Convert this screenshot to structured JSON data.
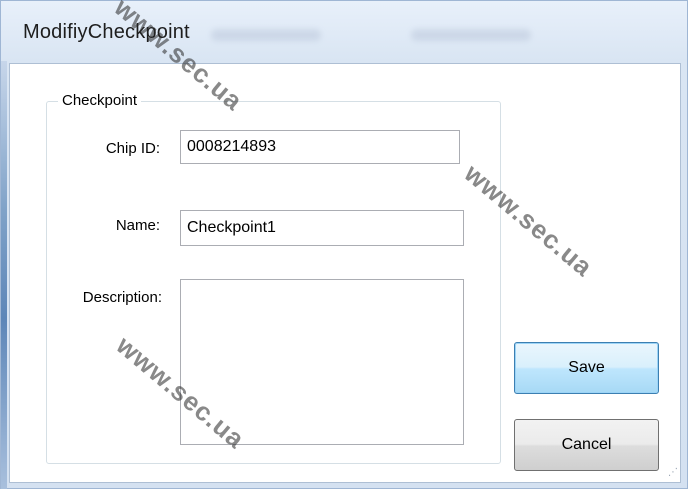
{
  "window": {
    "title": "ModifiyCheckpoint"
  },
  "group": {
    "legend": "Checkpoint"
  },
  "fields": {
    "chip_id_label": "Chip ID:",
    "chip_id_value": "0008214893",
    "name_label": "Name:",
    "name_value": "Checkpoint1",
    "description_label": "Description:",
    "description_value": ""
  },
  "buttons": {
    "save_label": "Save",
    "cancel_label": "Cancel"
  },
  "watermark": {
    "text": "www.sec.ua"
  },
  "colors": {
    "frame": "#d4e1f1",
    "client_bg": "#ffffff",
    "default_button_border": "#3c7fb1"
  }
}
